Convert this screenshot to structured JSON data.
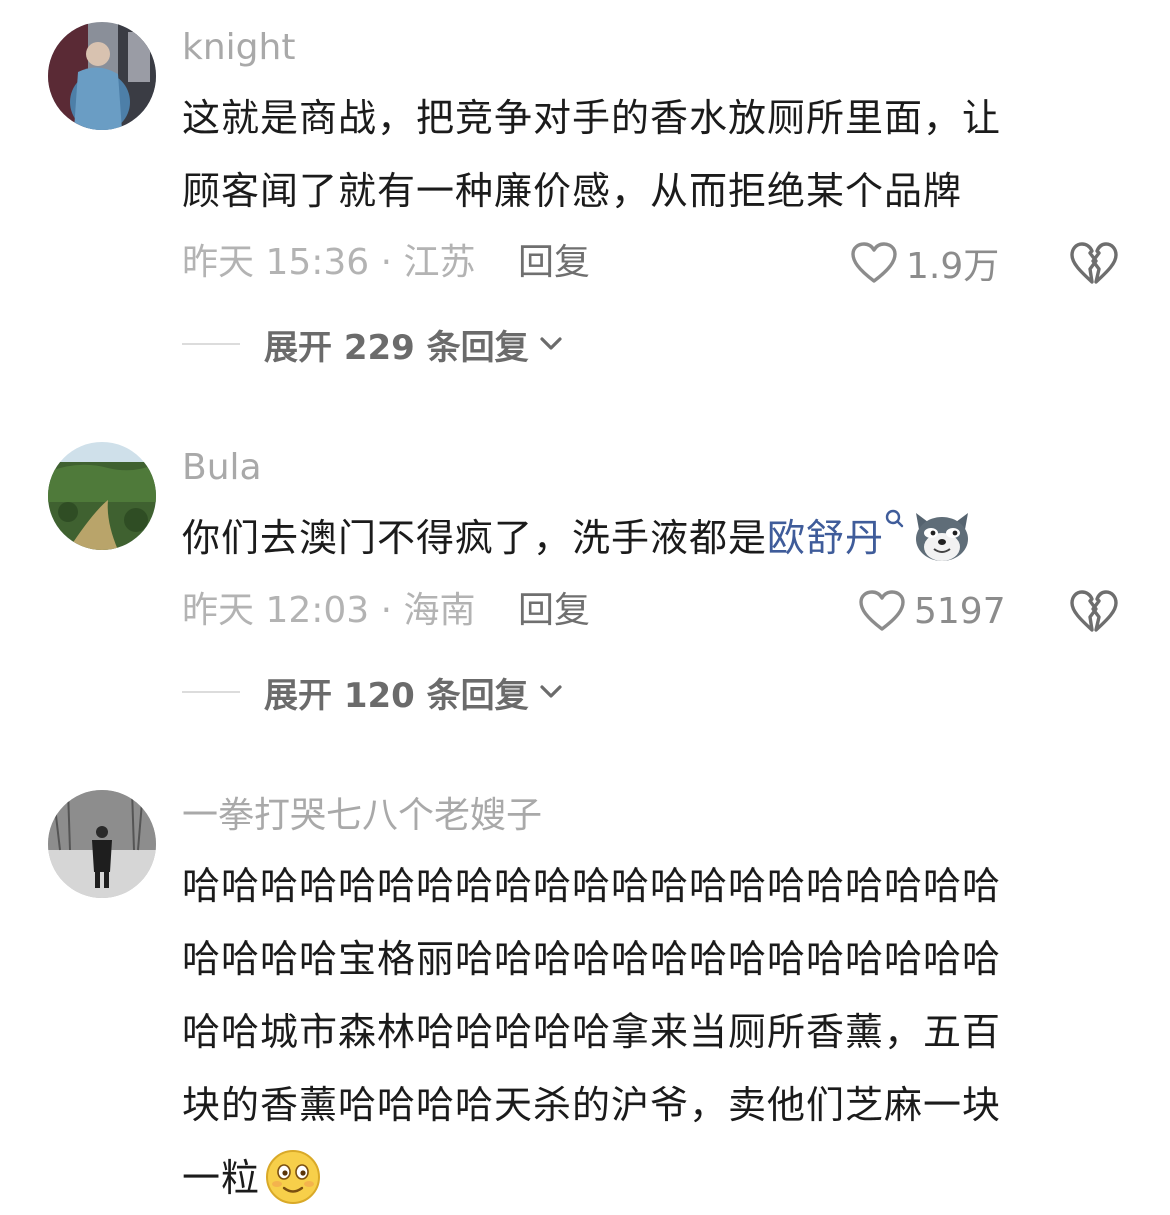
{
  "comments": [
    {
      "username": "knight",
      "text_lines": [
        "这就是商战，把竞争对手的香水放厕所里面，让",
        "顾客闻了就有一种廉价感，从而拒绝某个品牌"
      ],
      "meta": "昨天 15:36 · 江苏",
      "reply_label": "回复",
      "likes": "1.9万",
      "expand_label": "展开 229 条回复"
    },
    {
      "username": "Bula",
      "text_prefix": "你们去澳门不得疯了，洗手液都是",
      "text_link": "欧舒丹",
      "meta": "昨天 12:03 · 海南",
      "reply_label": "回复",
      "likes": "5197",
      "expand_label": "展开 120 条回复"
    },
    {
      "username": "一拳打哭七八个老嫂子",
      "text_lines": [
        "哈哈哈哈哈哈哈哈哈哈哈哈哈哈哈哈哈哈哈哈哈",
        "哈哈哈哈宝格丽哈哈哈哈哈哈哈哈哈哈哈哈哈哈",
        "哈哈城市森林哈哈哈哈哈拿来当厕所香薰，五百",
        "块的香薰哈哈哈哈天杀的沪爷，卖他们芝麻一块"
      ],
      "last_line": "一粒"
    }
  ],
  "icons": {
    "like": "heart-outline-icon",
    "dislike": "broken-heart-icon",
    "expand": "chevron-down-icon",
    "search": "search-icon",
    "emoji_dog": "doge-emoji",
    "emoji_smile": "smiling-face-emoji"
  }
}
